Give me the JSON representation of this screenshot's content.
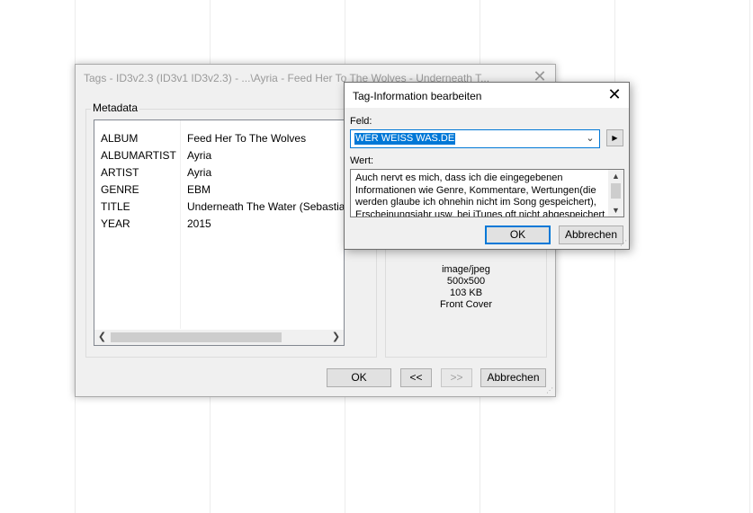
{
  "main_window": {
    "title": "Tags - ID3v2.3 (ID3v1 ID3v2.3) - ...\\Ayria - Feed Her To The Wolves - Underneath T...",
    "close_glyph": "✕",
    "metadata_label": "Metadata",
    "metadata_rows": [
      {
        "key": "ALBUM",
        "value": "Feed Her To The Wolves"
      },
      {
        "key": "ALBUMARTIST",
        "value": "Ayria"
      },
      {
        "key": "ARTIST",
        "value": "Ayria"
      },
      {
        "key": "GENRE",
        "value": "EBM"
      },
      {
        "key": "TITLE",
        "value": "Underneath The Water (Sebastian"
      },
      {
        "key": "YEAR",
        "value": "2015"
      }
    ],
    "cover_info": {
      "mime": "image/jpeg",
      "dimensions": "500x500",
      "size": "103 KB",
      "type": "Front Cover"
    },
    "buttons": {
      "ok": "OK",
      "prev": "<<",
      "next": ">>",
      "cancel": "Abbrechen"
    }
  },
  "dialog": {
    "title": "Tag-Information bearbeiten",
    "close_glyph": "✕",
    "feld_label": "Feld:",
    "feld_value": "WER WEISS WAS.DE",
    "wert_label": "Wert:",
    "wert_text": "Auch nervt es mich, dass ich die eingegebenen Informationen wie Genre, Kommentare, Wertungen(die werden glaube ich ohnehin nicht im Song gespeichert), Erscheinungsjahr usw. bei iTunes oft nicht abgespeichert",
    "ok_label": "OK",
    "cancel_label": "Abbrechen"
  },
  "colors": {
    "accent": "#0078d7",
    "window_bg": "#f0f0f0",
    "button_bg": "#e1e1e1"
  }
}
